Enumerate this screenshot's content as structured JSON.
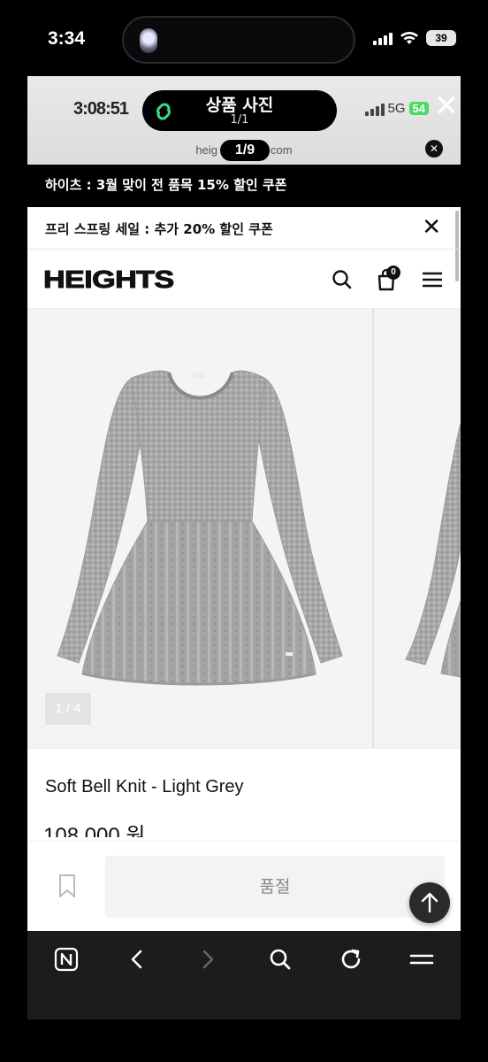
{
  "status_bar": {
    "time": "3:34",
    "battery": "39"
  },
  "viewer": {
    "inner_time": "3:08:51",
    "inner_battery": "54",
    "inner_network": "5G",
    "title": "상품 사진",
    "count": "1/1",
    "url_prefix": "heig",
    "url_suffix": "com",
    "page_indicator": "1/9",
    "close_icon": "close-icon"
  },
  "promo": {
    "text": "하이츠 : 3월 맞이 전 품목 15% 할인 쿠폰"
  },
  "banner": {
    "text": "프리 스프링 세일 : 추가 20% 할인 쿠폰"
  },
  "header": {
    "logo": "HEIGHTS",
    "cart_count": "0"
  },
  "gallery": {
    "counter": "1 / 4",
    "product_color": "#a9a9a9"
  },
  "product": {
    "name": "Soft Bell Knit - Light Grey",
    "price": "108,000 원"
  },
  "actions": {
    "soldout_label": "품절"
  },
  "toolbar": {
    "home_glyph": "N"
  }
}
